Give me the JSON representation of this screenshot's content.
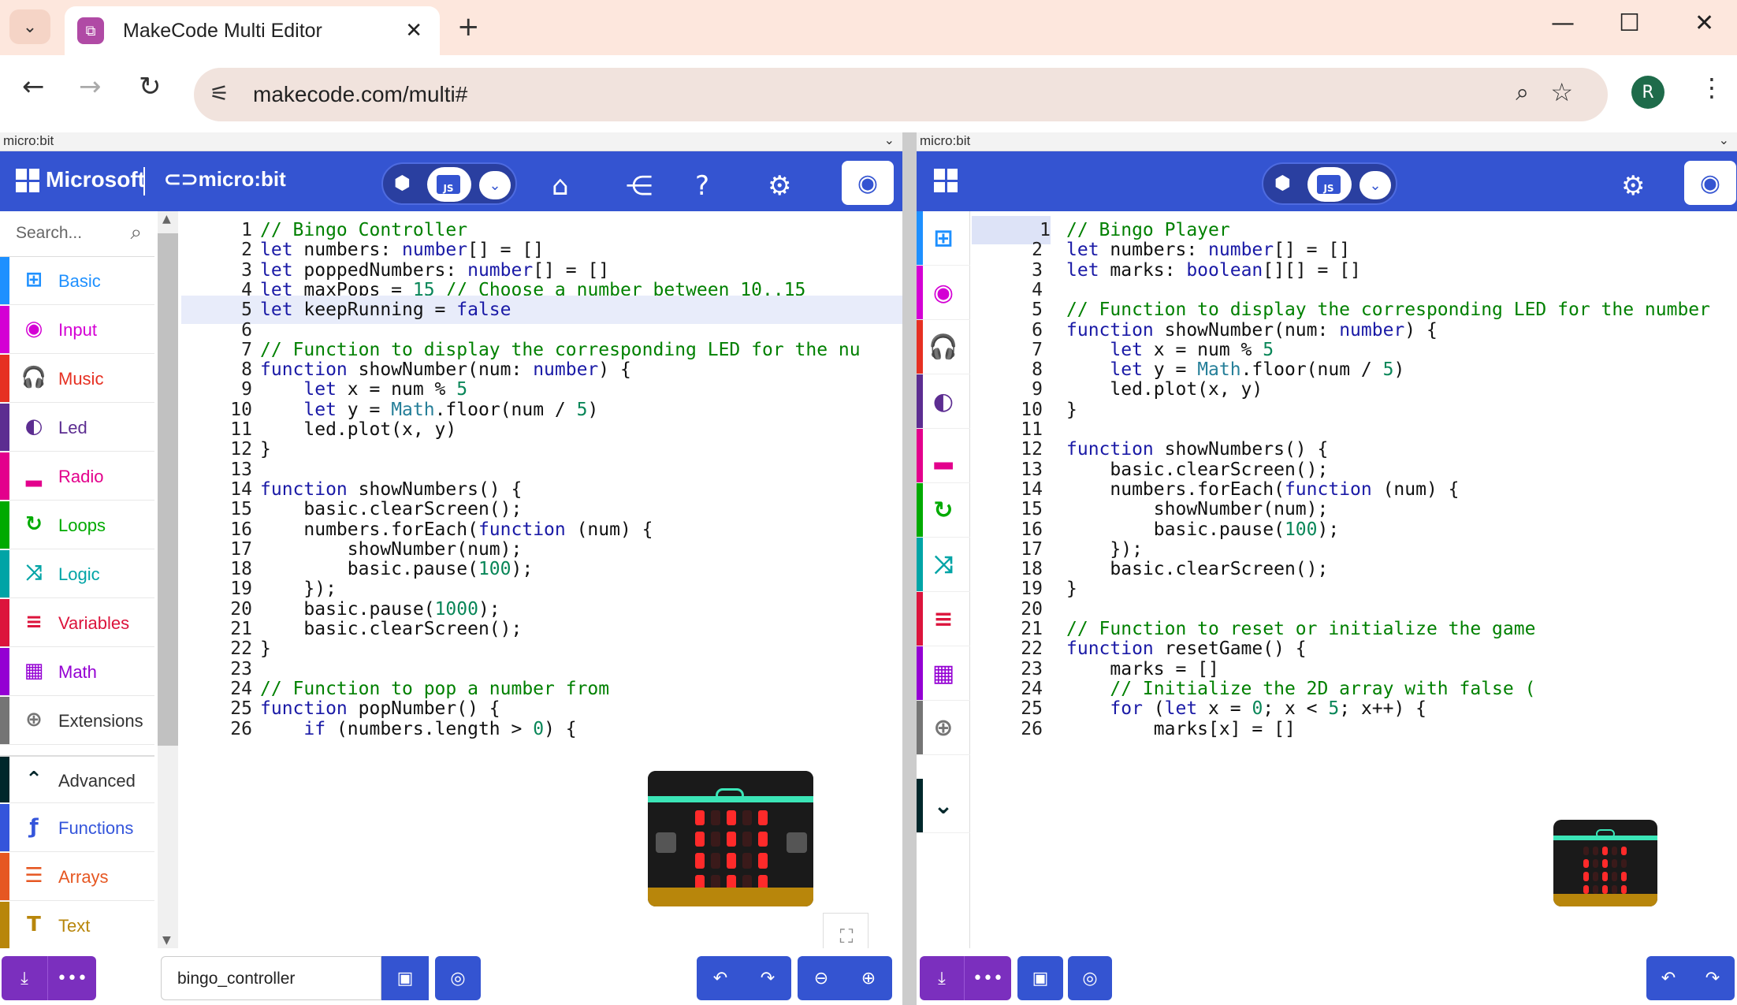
{
  "browser": {
    "tab_title": "MakeCode Multi Editor",
    "url": "makecode.com/multi#",
    "avatar_letter": "R",
    "tab_close": "✕",
    "new_tab": "+",
    "window_controls": {
      "minimize": "—",
      "maximize": "☐",
      "close": "✕"
    }
  },
  "left": {
    "pane_label": "micro:bit",
    "brand_ms": "Microsoft",
    "brand_mb": "micro:bit",
    "search_placeholder": "Search...",
    "categories": [
      {
        "label": "Basic",
        "color": "#1e90ff",
        "icon": "⊞"
      },
      {
        "label": "Input",
        "color": "#d400d4",
        "icon": "◉"
      },
      {
        "label": "Music",
        "color": "#e63022",
        "icon": "🎧"
      },
      {
        "label": "Led",
        "color": "#5c2d91",
        "icon": "◐"
      },
      {
        "label": "Radio",
        "color": "#e3008c",
        "icon": "▂"
      },
      {
        "label": "Loops",
        "color": "#00aa00",
        "icon": "↻"
      },
      {
        "label": "Logic",
        "color": "#00a4a6",
        "icon": "⤨"
      },
      {
        "label": "Variables",
        "color": "#dc143c",
        "icon": "≡"
      },
      {
        "label": "Math",
        "color": "#9400d3",
        "icon": "▦"
      },
      {
        "label": "Extensions",
        "color": "#757575",
        "icon": "⊕"
      },
      {
        "label": "Advanced",
        "color": "#00272b",
        "icon": "⌃"
      },
      {
        "label": "Functions",
        "color": "#3455db",
        "icon": "ƒ"
      },
      {
        "label": "Arrays",
        "color": "#e65722",
        "icon": "☰"
      },
      {
        "label": "Text",
        "color": "#b8860b",
        "icon": "T"
      }
    ],
    "code": [
      "// Bingo Controller",
      "let numbers: number[] = []",
      "let poppedNumbers: number[] = []",
      "let maxPops = 15 // Choose a number between 10..15",
      "let keepRunning = false",
      "",
      "// Function to display the corresponding LED for the nu",
      "function showNumber(num: number) {",
      "    let x = num % 5",
      "    let y = Math.floor(num / 5)",
      "    led.plot(x, y)",
      "}",
      "",
      "function showNumbers() {",
      "    basic.clearScreen();",
      "    numbers.forEach(function (num) {",
      "        showNumber(num);",
      "        basic.pause(100);",
      "    });",
      "    basic.pause(1000);",
      "    basic.clearScreen();",
      "}",
      "",
      "// Function to pop a number from",
      "function popNumber() {",
      "    if (numbers.length > 0) {"
    ],
    "line_numbers": [
      "1",
      "2",
      "3",
      "4",
      "5",
      "6",
      "7",
      "8",
      "9",
      "10",
      "11",
      "12",
      "13",
      "14",
      "15",
      "16",
      "17",
      "18",
      "19",
      "20",
      "21",
      "22",
      "23",
      "24",
      "25",
      "26"
    ],
    "project_name": "bingo_controller"
  },
  "right": {
    "pane_label": "micro:bit",
    "code": [
      "// Bingo Player",
      "let numbers: number[] = []",
      "let marks: boolean[][] = []",
      "",
      "// Function to display the corresponding LED for the number",
      "function showNumber(num: number) {",
      "    let x = num % 5",
      "    let y = Math.floor(num / 5)",
      "    led.plot(x, y)",
      "}",
      "",
      "function showNumbers() {",
      "    basic.clearScreen();",
      "    numbers.forEach(function (num) {",
      "        showNumber(num);",
      "        basic.pause(100);",
      "    });",
      "    basic.clearScreen();",
      "}",
      "",
      "// Function to reset or initialize the game",
      "function resetGame() {",
      "    marks = []",
      "    // Initialize the 2D array with false (",
      "    for (let x = 0; x < 5; x++) {",
      "        marks[x] = []"
    ],
    "line_numbers": [
      "1",
      "2",
      "3",
      "4",
      "5",
      "6",
      "7",
      "8",
      "9",
      "10",
      "11",
      "12",
      "13",
      "14",
      "15",
      "16",
      "17",
      "18",
      "19",
      "20",
      "21",
      "22",
      "23",
      "24",
      "25",
      "26"
    ]
  }
}
